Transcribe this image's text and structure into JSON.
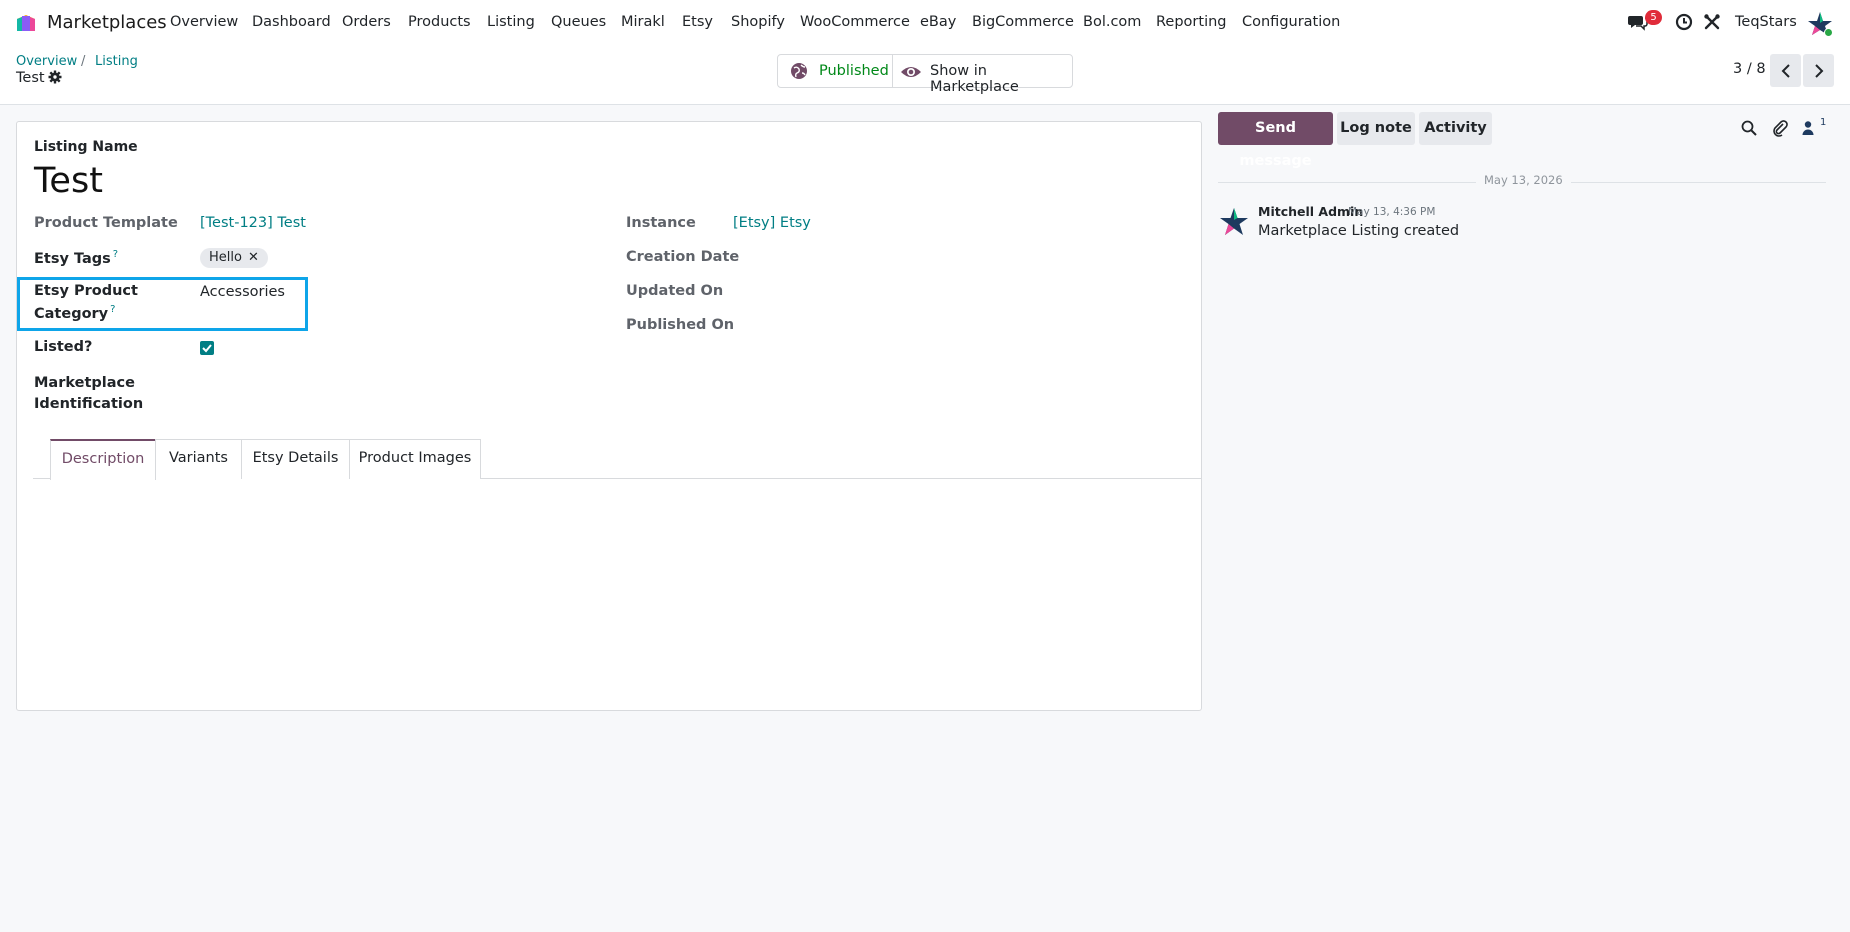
{
  "app": {
    "name": "Marketplaces"
  },
  "menu": [
    "Overview",
    "Dashboard",
    "Orders",
    "Products",
    "Listing",
    "Queues",
    "Mirakl",
    "Etsy",
    "Shopify",
    "WooCommerce",
    "eBay",
    "BigCommerce",
    "Bol.com",
    "Reporting",
    "Configuration"
  ],
  "systray": {
    "messages_badge": "5",
    "company": "TeqStars"
  },
  "breadcrumb": {
    "items": [
      "Overview",
      "Listing"
    ],
    "current": "Test"
  },
  "status_buttons": {
    "published": "Published",
    "show": "Show in Marketplace"
  },
  "pager": {
    "value": "3 / 8"
  },
  "form": {
    "name_label": "Listing Name",
    "name": "Test",
    "product_template_label": "Product Template",
    "product_template": "[Test-123] Test",
    "etsy_tags_label": "Etsy Tags",
    "etsy_tags": [
      "Hello"
    ],
    "category_label_1": "Etsy Product",
    "category_label_2": "Category",
    "category": "Accessories",
    "listed_label": "Listed?",
    "listed": true,
    "marketplace_id_label_1": "Marketplace",
    "marketplace_id_label_2": "Identification",
    "instance_label": "Instance",
    "instance": "[Etsy] Etsy",
    "creation_date_label": "Creation Date",
    "updated_on_label": "Updated On",
    "published_on_label": "Published On",
    "help_mark": "?"
  },
  "tabs": [
    "Description",
    "Variants",
    "Etsy Details",
    "Product Images"
  ],
  "chatter": {
    "send_message": "Send message",
    "log_note": "Log note",
    "activity": "Activity",
    "followers_count": "1",
    "date_separator": "May 13, 2026",
    "message": {
      "author": "Mitchell Admin",
      "date": "May 13, 4:36 PM",
      "body": "Marketplace Listing created"
    }
  },
  "colors": {
    "brand": "#714b67",
    "link": "#017e84",
    "highlight": "#0ea5e9",
    "published": "#008818"
  }
}
